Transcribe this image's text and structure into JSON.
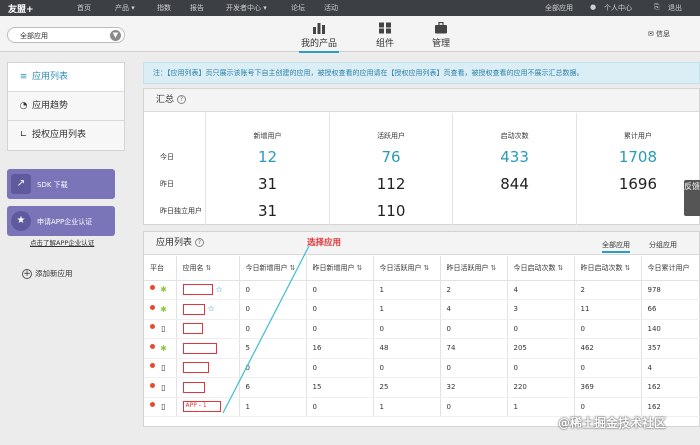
{
  "topnav": {
    "logo": "友盟+",
    "items": [
      "首页",
      "产品 ▾",
      "指数",
      "报告",
      "开发者中心 ▾",
      "论坛",
      "活动"
    ],
    "right": [
      "全部应用",
      "个人中心",
      "退出"
    ]
  },
  "subhead": {
    "app_select": "全部应用",
    "tabs": [
      "我的产品",
      "组件",
      "管理"
    ],
    "message": "信息"
  },
  "sidebar": {
    "items": [
      "应用列表",
      "应用趋势",
      "授权应用列表"
    ],
    "sdk_button": "SDK 下载",
    "cert_button": "申请APP企业认证",
    "cert_link": "点击了解APP企业认证",
    "add_app": "添加新应用"
  },
  "notice": "注：【应用列表】页只展示该账号下自主创建的应用，被授权查看的应用请在【授权应用列表】页查看，被授权查看的应用不展示汇总数据。",
  "summary": {
    "title": "汇总",
    "columns": [
      "新增用户",
      "活跃用户",
      "启动次数",
      "累计用户"
    ],
    "rows": [
      {
        "label": "今日",
        "values": [
          "12",
          "76",
          "433",
          "1708"
        ]
      },
      {
        "label": "昨日",
        "values": [
          "31",
          "112",
          "844",
          "1696"
        ]
      },
      {
        "label": "昨日独立用户",
        "values": [
          "31",
          "110",
          "",
          ""
        ]
      }
    ]
  },
  "feedback": "反馈",
  "app_list": {
    "title": "应用列表",
    "tabs": [
      "全部应用",
      "分组应用"
    ],
    "annotation": "选择应用",
    "columns": [
      "平台",
      "应用名",
      "今日新增用户",
      "昨日新增用户",
      "今日活跃用户",
      "昨日活跃用户",
      "今日启动次数",
      "昨日启动次数",
      "今日累计用户"
    ],
    "rows": [
      {
        "platform": "android",
        "name": "",
        "star": true,
        "values": [
          "0",
          "0",
          "1",
          "2",
          "4",
          "2",
          "978"
        ]
      },
      {
        "platform": "android",
        "name": "",
        "star": true,
        "values": [
          "0",
          "0",
          "1",
          "4",
          "3",
          "11",
          "66"
        ]
      },
      {
        "platform": "ios",
        "name": "",
        "star": false,
        "values": [
          "0",
          "0",
          "0",
          "0",
          "0",
          "0",
          "140"
        ]
      },
      {
        "platform": "android",
        "name": "",
        "star": false,
        "values": [
          "5",
          "16",
          "48",
          "74",
          "205",
          "462",
          "357"
        ]
      },
      {
        "platform": "ios",
        "name": "",
        "star": false,
        "values": [
          "0",
          "0",
          "0",
          "0",
          "0",
          "0",
          "4"
        ]
      },
      {
        "platform": "ios",
        "name": "",
        "star": false,
        "values": [
          "6",
          "15",
          "25",
          "32",
          "220",
          "369",
          "162"
        ]
      },
      {
        "platform": "ios",
        "name": "APP - 1",
        "star": false,
        "values": [
          "1",
          "0",
          "1",
          "0",
          "1",
          "0",
          "162"
        ]
      }
    ]
  },
  "watermark": "@稀土掘金技术社区",
  "colors": {
    "accent": "#2a9ab8",
    "nav": "#3c3f44",
    "sidebar_button": "#7a74b8",
    "highlight": "#e2343a"
  }
}
